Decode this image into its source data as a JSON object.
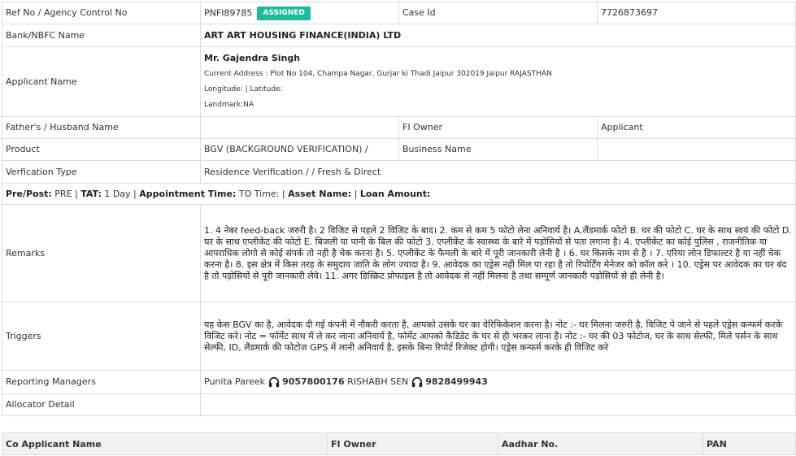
{
  "ref": {
    "label": "Ref No / Agency Control No",
    "value": "PNFI89785",
    "status": "ASSIGNED",
    "case_label": "Case Id",
    "case_value": "7726873697"
  },
  "bank": {
    "label": "Bank/NBFC Name",
    "value": "ART ART HOUSING FINANCE(INDIA) LTD"
  },
  "applicant": {
    "label": "Applicant Name",
    "name": "Mr. Gajendra Singh",
    "address": "Current Address : Plot No 104, Champa Nagar, Gurjar ki Thadi Jaipur 302019 Jaipur RAJASTHAN",
    "coords": "Longitude: | Latitude:",
    "landmark": "Landmark:NA"
  },
  "father": {
    "label": "Father's / Husband Name",
    "value": "",
    "fi_owner_label": "FI Owner",
    "fi_owner_value": "Applicant"
  },
  "product": {
    "label": "Product",
    "value": "BGV (BACKGROUND VERIFICATION) /",
    "business_label": "Business Name",
    "business_value": ""
  },
  "verification": {
    "label": "Verfication Type",
    "value": "Residence Verification / / Fresh & Direct"
  },
  "summary": {
    "prepost_label": "Pre/Post:",
    "prepost_value": "PRE",
    "tat_label": "TAT:",
    "tat_value": "1 Day",
    "appt_label": "Appointment Time:",
    "appt_value": "TO Time:",
    "asset_label": "Asset Name:",
    "loan_label": "Loan Amount:"
  },
  "remarks": {
    "label": "Remarks",
    "text": "1. 4 नेबर feed-back जरुरी है। 2 विजिट से पहले 2 विजिट के बाद। 2. कम से कम 5 फोटो लेना अनिवार्य है। A.लैंडमार्क फोटो B. घर की फोटो C. घर के साथ स्वयं की फोटो D. घर के साथ एप्लीकेंट की फोटो E. बिजली या पानी के बिल की फोटो 3. एप्लीकेंट के स्वास्थ्य के बारे में पड़ोसियों से पता लगाना है। 4. एप्लीकेंट का कोई पुलिस , राजनीतिक या आपराधिक लोगो से कोई संपर्क तो नही है चेक करना है। 5. एप्लीकेंट के फैमली के बारे में पूरी जानकारी लेनी है । 6. घर किसके नाम से है । 7. एरिया लोन डिफाल्टर है या नहीं चेक करना है। 8. इस क्षेत्र में किस तरह के समुदाय जाति के लोग ज्यादा है। 9. आवेदक का एड्रेस नही मिल पा रहा है तो रिपोर्टिंग मेनेजर को कॉल करे । 10. एड्रेस पर आवेदक का घर बंद है तो पड़ोसियों से पूरी जानकारी लेवे। 11. अगर डिस्क्रिट प्रोफाइल है तो आवेदक से नहीं मिलना है तथा सम्पूर्ण जानकारी पड़ोसियों से ही लेनी है।"
  },
  "triggers": {
    "label": "Triggers",
    "text": "यह केस BGV का है, आवेदक दी गई कंपनी में नौकरी करता है, आपको उसके घर का वेरिफिकेशन करना है। नोट :- घर मिलना जरुरी है, विजिट पे जाने से पहले एड्रेस कन्फर्म करके विजिट करे। नोट = फॉर्मेट साथ में ले कर जाना अनिवार्य है, फॉर्मेट आपको कैंडिडेट के घर से ही भरकर लाना है। नोट :- घर की 03 फोटोज, घर के साथ सेल्फी, मिले पर्सन के साथ सेल्फी, ID, लैंडमार्क की फोटोज GPS में लानी अनिवार्य है, इसके बिना रिपोर्ट रिजेक्ट होगी। एड्रेस कन्फर्म करके ही विजिट करे"
  },
  "managers": {
    "label": "Reporting Managers",
    "m1_name": "Punita Pareek",
    "m1_phone": "9057800176",
    "m2_name": "RISHABH SEN",
    "m2_phone": "9828499943",
    "icon": "headphones-icon"
  },
  "allocator": {
    "label": "Allocator Detail",
    "value": ""
  },
  "co_applicant": {
    "headers": [
      "Co Applicant Name",
      "FI Owner",
      "Aadhar No.",
      "PAN"
    ]
  },
  "colors": {
    "badge": "#1bbc9b",
    "border": "#dddddd",
    "header_bg": "#f2f2f2"
  }
}
